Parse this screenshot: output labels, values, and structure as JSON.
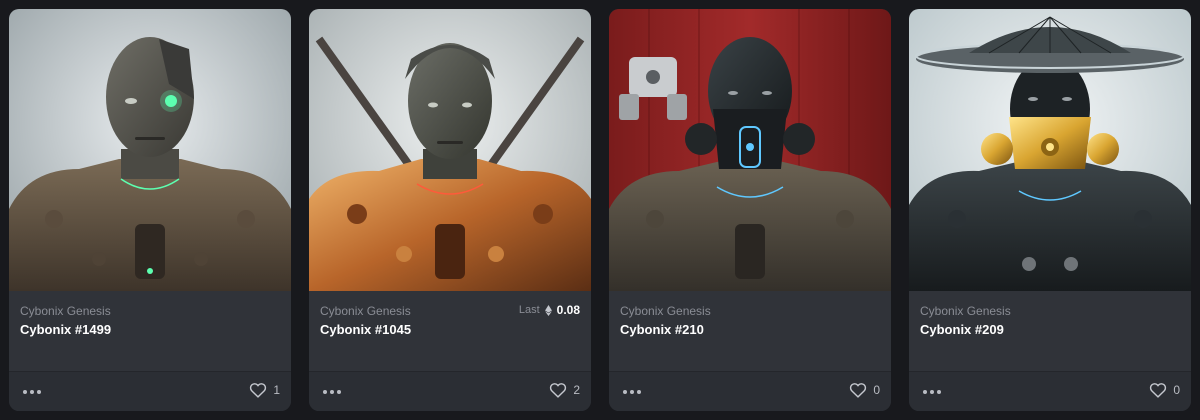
{
  "cards": [
    {
      "collection": "Cybonix Genesis",
      "title": "Cybonix #1499",
      "likes": "1",
      "image": "rusted cyborg with green eye implant",
      "has_last": false
    },
    {
      "collection": "Cybonix Genesis",
      "title": "Cybonix #1045",
      "likes": "2",
      "image": "bronze armored cyborg with crossed swords",
      "has_last": true,
      "last_label": "Last",
      "last_price": "0.08",
      "currency_icon": "ethereum-icon"
    },
    {
      "collection": "Cybonix Genesis",
      "title": "Cybonix #210",
      "likes": "0",
      "image": "dark cyborg with gas mask and drone on red background",
      "has_last": false
    },
    {
      "collection": "Cybonix Genesis",
      "title": "Cybonix #209",
      "likes": "0",
      "image": "dark cyborg with gold mask and conical hat",
      "has_last": false
    }
  ],
  "icons": {
    "more": "more-options-icon",
    "like": "heart-icon"
  },
  "colors": {
    "page_bg": "#18191d",
    "card_bg": "#303339",
    "footer_bg": "#2b2e34",
    "text_primary": "#ffffff",
    "text_secondary": "#8a8d95",
    "bg_red": "#8e2222",
    "gold": "#d9a531",
    "rust": "#6b5a48",
    "accent_green": "#5dffb0",
    "accent_blue": "#5fc8ff"
  }
}
